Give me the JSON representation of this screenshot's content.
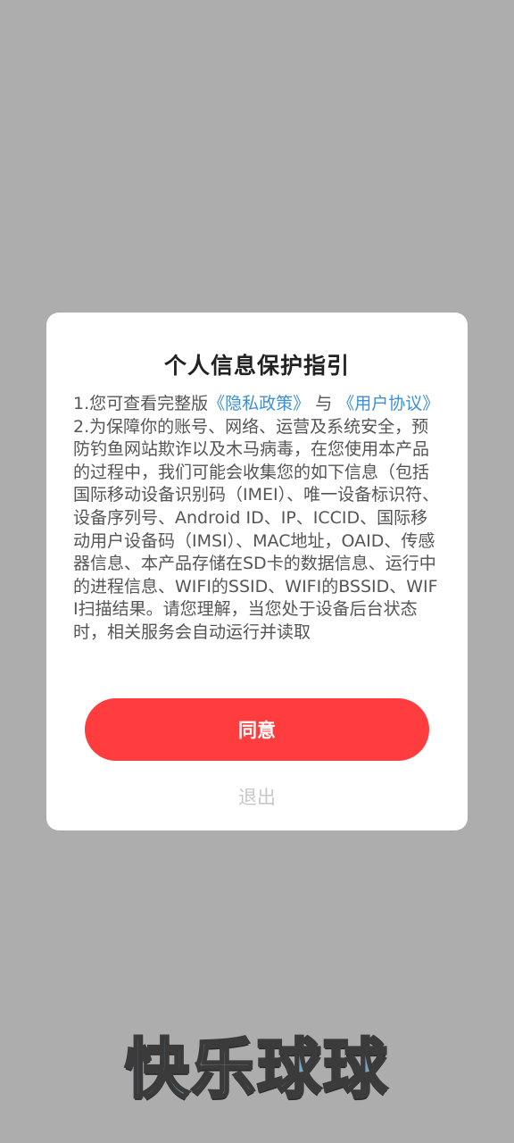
{
  "dialog": {
    "title": "个人信息保护指引",
    "item1_prefix": "1.您可查看完整版",
    "privacy_link": "《隐私政策》",
    "item1_connector": "与",
    "user_agreement_link": "《用户协议》",
    "item2_text": "2.为保障你的账号、网络、运营及系统安全，预防钓鱼网站欺诈以及木马病毒，在您使用本产品的过程中，我们可能会收集您的如下信息（包括国际移动设备识别码（IMEI）、唯一设备标识符、设备序列号、Android ID、IP、ICCID、国际移动用户设备码（IMSI）、MAC地址，OAID、传感器信息、本产品存储在SD卡的数据信息、运行中的进程信息、WIFI的SSID、WIFI的BSSID、WIFI扫描结果。请您理解，当您处于设备后台状态时，相关服务会自动运行并读取",
    "agree_label": "同意",
    "exit_label": "退出"
  },
  "branding": {
    "app_name": "快乐球球"
  },
  "colors": {
    "overlay": "#adadad",
    "accent": "#ff3d3f",
    "link": "#3d8fd6"
  }
}
